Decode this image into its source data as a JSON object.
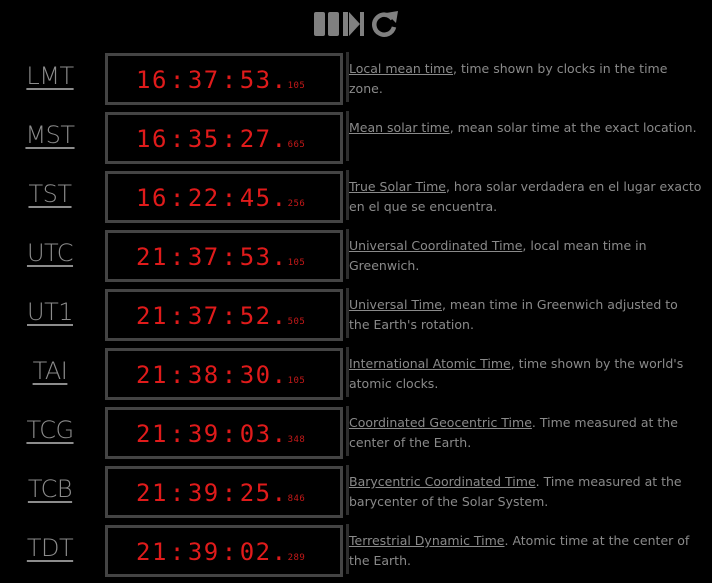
{
  "toolbar": {
    "buttons": [
      {
        "name": "pause-button",
        "icon": "pause-icon"
      },
      {
        "name": "step-button",
        "icon": "step-forward-icon"
      },
      {
        "name": "reload-button",
        "icon": "reload-icon"
      }
    ],
    "icon_color": "#808080"
  },
  "colors": {
    "background": "#000000",
    "clock_digits": "#e01b1b",
    "clock_border": "#444444",
    "text": "#8a8a8a"
  },
  "rows": [
    {
      "abbr": "LMT",
      "time": {
        "h": "16",
        "m": "37",
        "s": "53",
        "ms": "105"
      },
      "link": "Local mean time",
      "rest": ", time shown by clocks in the time zone."
    },
    {
      "abbr": "MST",
      "time": {
        "h": "16",
        "m": "35",
        "s": "27",
        "ms": "665"
      },
      "link": "Mean solar time",
      "rest": ", mean solar time at the exact location."
    },
    {
      "abbr": "TST",
      "time": {
        "h": "16",
        "m": "22",
        "s": "45",
        "ms": "256"
      },
      "link": "True Solar Time",
      "rest": ", hora solar verdadera en el lugar exacto en el que se encuentra."
    },
    {
      "abbr": "UTC",
      "time": {
        "h": "21",
        "m": "37",
        "s": "53",
        "ms": "105"
      },
      "link": "Universal Coordinated Time",
      "rest": ", local mean time in Greenwich."
    },
    {
      "abbr": "UT1",
      "time": {
        "h": "21",
        "m": "37",
        "s": "52",
        "ms": "505"
      },
      "link": "Universal Time",
      "rest": ", mean time in Greenwich adjusted to the Earth's rotation."
    },
    {
      "abbr": "TAI",
      "time": {
        "h": "21",
        "m": "38",
        "s": "30",
        "ms": "105"
      },
      "link": "International Atomic Time",
      "rest": ", time shown by the world's atomic clocks."
    },
    {
      "abbr": "TCG",
      "time": {
        "h": "21",
        "m": "39",
        "s": "03",
        "ms": "348"
      },
      "link": "Coordinated Geocentric Time",
      "rest": ". Time measured at the center of the Earth."
    },
    {
      "abbr": "TCB",
      "time": {
        "h": "21",
        "m": "39",
        "s": "25",
        "ms": "846"
      },
      "link": "Barycentric Coordinated Time",
      "rest": ". Time measured at the barycenter of the Solar System."
    },
    {
      "abbr": "TDT",
      "time": {
        "h": "21",
        "m": "39",
        "s": "02",
        "ms": "289"
      },
      "link": "Terrestrial Dynamic Time",
      "rest": ". Atomic time at the center of the Earth."
    }
  ]
}
